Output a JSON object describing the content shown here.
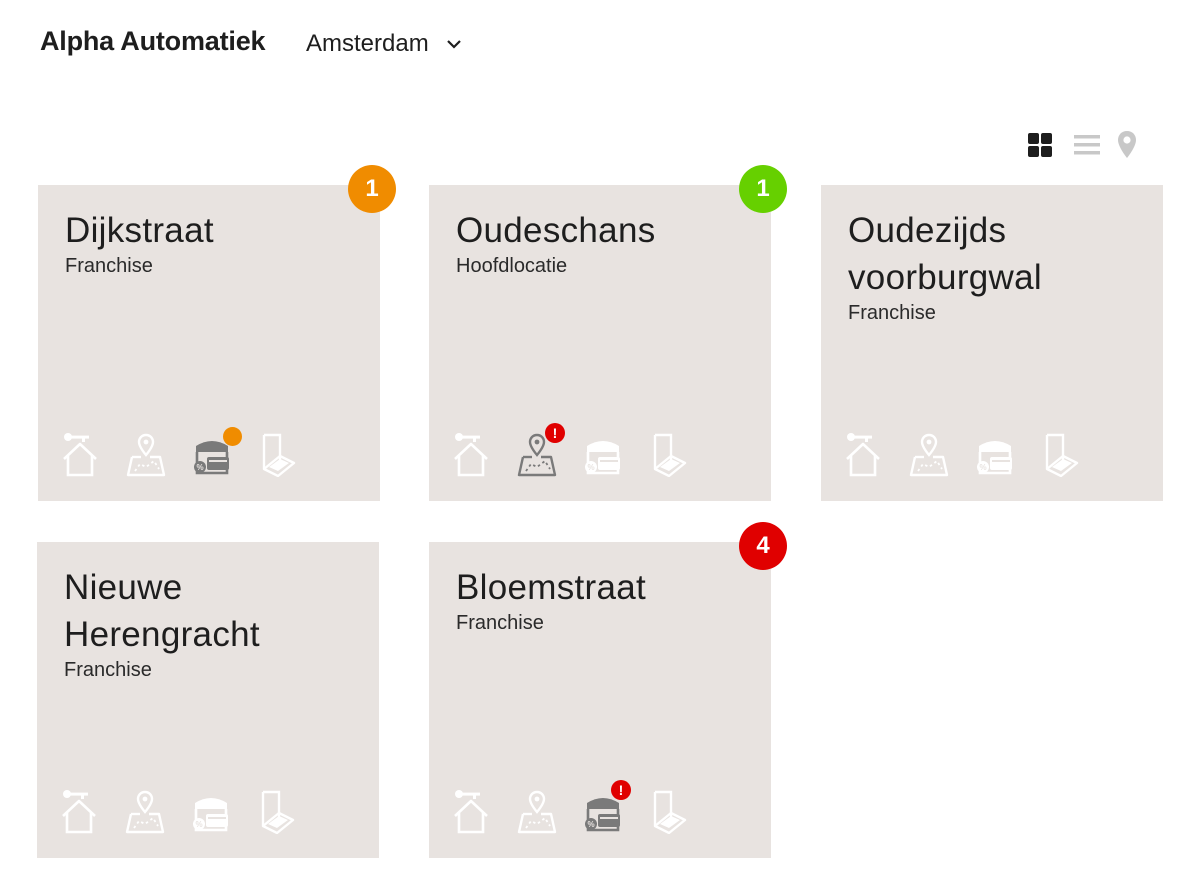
{
  "header": {
    "company": "Alpha Automatiek",
    "city": "Amsterdam"
  },
  "view_toggles": [
    {
      "name": "grid-view-icon",
      "active": true
    },
    {
      "name": "list-view-icon",
      "active": false
    },
    {
      "name": "map-view-icon",
      "active": false
    }
  ],
  "colors": {
    "card_bg": "#e8e3e0",
    "icon_inactive": "#ffffff",
    "icon_active": "#7a7a7a",
    "orange": "#f08c00",
    "green": "#66d000",
    "red": "#e00000"
  },
  "cards": [
    {
      "title": "Dijkstraat",
      "subtitle": "Franchise",
      "badge": "1",
      "badge_color": "#f08c00",
      "icons": [
        {
          "name": "house-key-icon",
          "active": false,
          "mark": ""
        },
        {
          "name": "map-pin-icon",
          "active": false,
          "mark": ""
        },
        {
          "name": "shop-discount-icon",
          "active": true,
          "mark": "orange-dot"
        },
        {
          "name": "scanner-icon",
          "active": false,
          "mark": ""
        }
      ]
    },
    {
      "title": "Oudeschans",
      "subtitle": "Hoofdlocatie",
      "badge": "1",
      "badge_color": "#66d000",
      "icons": [
        {
          "name": "house-key-icon",
          "active": false,
          "mark": ""
        },
        {
          "name": "map-pin-icon",
          "active": true,
          "mark": "alert"
        },
        {
          "name": "shop-discount-icon",
          "active": false,
          "mark": ""
        },
        {
          "name": "scanner-icon",
          "active": false,
          "mark": ""
        }
      ]
    },
    {
      "title": "Oudezijds voorburgwal",
      "subtitle": "Franchise",
      "badge": "",
      "badge_color": "",
      "icons": [
        {
          "name": "house-key-icon",
          "active": false,
          "mark": ""
        },
        {
          "name": "map-pin-icon",
          "active": false,
          "mark": ""
        },
        {
          "name": "shop-discount-icon",
          "active": false,
          "mark": ""
        },
        {
          "name": "scanner-icon",
          "active": false,
          "mark": ""
        }
      ]
    },
    {
      "title": "Nieuwe Herengracht",
      "subtitle": "Franchise",
      "badge": "",
      "badge_color": "",
      "icons": [
        {
          "name": "house-key-icon",
          "active": false,
          "mark": ""
        },
        {
          "name": "map-pin-icon",
          "active": false,
          "mark": ""
        },
        {
          "name": "shop-discount-icon",
          "active": false,
          "mark": ""
        },
        {
          "name": "scanner-icon",
          "active": false,
          "mark": ""
        }
      ]
    },
    {
      "title": "Bloemstraat",
      "subtitle": "Franchise",
      "badge": "4",
      "badge_color": "#e00000",
      "icons": [
        {
          "name": "house-key-icon",
          "active": false,
          "mark": ""
        },
        {
          "name": "map-pin-icon",
          "active": false,
          "mark": ""
        },
        {
          "name": "shop-discount-icon",
          "active": true,
          "mark": "alert"
        },
        {
          "name": "scanner-icon",
          "active": false,
          "mark": ""
        }
      ]
    }
  ]
}
